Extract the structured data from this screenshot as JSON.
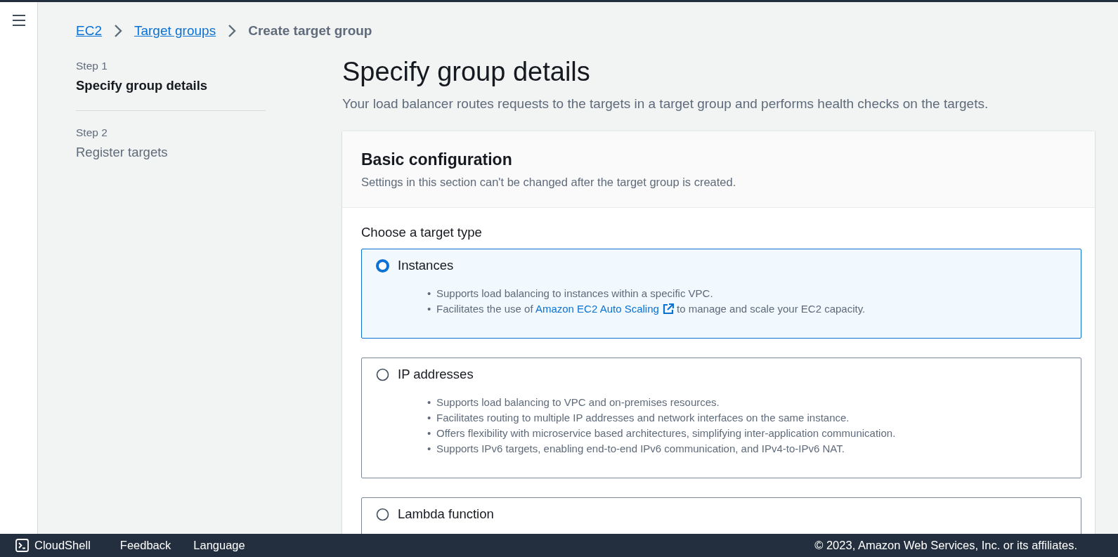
{
  "breadcrumbs": [
    {
      "label": "EC2",
      "kind": "link"
    },
    {
      "label": "Target groups",
      "kind": "link"
    },
    {
      "label": "Create target group",
      "kind": "current"
    }
  ],
  "steps": [
    {
      "step": "Step 1",
      "title": "Specify group details",
      "selected": true
    },
    {
      "step": "Step 2",
      "title": "Register targets",
      "selected": false
    }
  ],
  "page": {
    "title": "Specify group details",
    "description": "Your load balancer routes requests to the targets in a target group and performs health checks on the targets."
  },
  "card": {
    "title": "Basic configuration",
    "subtitle": "Settings in this section can't be changed after the target group is created.",
    "field_label": "Choose a target type",
    "options": [
      {
        "label": "Instances",
        "selected": true,
        "bullets": [
          {
            "marker": "•",
            "parts": [
              {
                "kind": "text",
                "text": "Supports load balancing to instances within a specific VPC."
              }
            ]
          },
          {
            "marker": "•",
            "parts": [
              {
                "kind": "text",
                "text": "Facilitates the use of "
              },
              {
                "kind": "external_link",
                "text": "Amazon EC2 Auto Scaling"
              },
              {
                "kind": "text",
                "text": " to manage and scale your EC2 capacity."
              }
            ]
          }
        ]
      },
      {
        "label": "IP addresses",
        "selected": false,
        "bullets": [
          {
            "marker": "•",
            "parts": [
              {
                "kind": "text",
                "text": "Supports load balancing to VPC and on-premises resources."
              }
            ]
          },
          {
            "marker": "•",
            "parts": [
              {
                "kind": "text",
                "text": "Facilitates routing to multiple IP addresses and network interfaces on the same instance."
              }
            ]
          },
          {
            "marker": "•",
            "parts": [
              {
                "kind": "text",
                "text": "Offers flexibility with microservice based architectures, simplifying inter-application communication."
              }
            ]
          },
          {
            "marker": "•",
            "parts": [
              {
                "kind": "text",
                "text": "Supports IPv6 targets, enabling end-to-end IPv6 communication, and IPv4-to-IPv6 NAT."
              }
            ]
          }
        ]
      },
      {
        "label": "Lambda function",
        "selected": false
      }
    ]
  },
  "footer": {
    "items": [
      {
        "label": "CloudShell",
        "kind": "cloudshell"
      },
      {
        "label": "Feedback",
        "kind": "plain"
      },
      {
        "label": "Language",
        "kind": "plain"
      }
    ],
    "copyright": "© 2023, Amazon Web Services, Inc. or its affiliates."
  }
}
